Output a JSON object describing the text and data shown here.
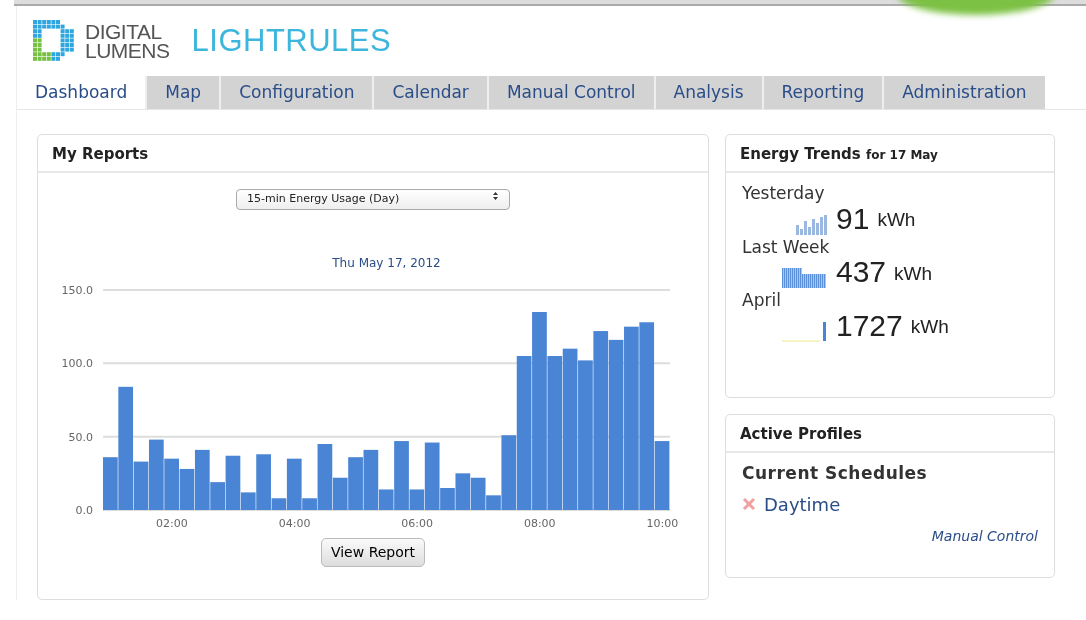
{
  "brand": {
    "company_line_1": "DIGITAL",
    "company_line_2": "LUMENS",
    "product": "LIGHTRULES"
  },
  "tabs": [
    {
      "label": "Dashboard",
      "selected": true
    },
    {
      "label": "Map",
      "selected": false
    },
    {
      "label": "Configuration",
      "selected": false
    },
    {
      "label": "Calendar",
      "selected": false
    },
    {
      "label": "Manual Control",
      "selected": false
    },
    {
      "label": "Analysis",
      "selected": false
    },
    {
      "label": "Reporting",
      "selected": false
    },
    {
      "label": "Administration",
      "selected": false
    }
  ],
  "my_reports": {
    "title": "My Reports",
    "report_select": "15-min Energy Usage (Day)",
    "button": "View Report",
    "chart_data": {
      "type": "bar",
      "title": "Thu May 17, 2012",
      "x": [
        1,
        1.25,
        1.5,
        1.75,
        2,
        2.25,
        2.5,
        2.75,
        3,
        3.25,
        3.5,
        3.75,
        4,
        4.25,
        4.5,
        4.75,
        5,
        5.25,
        5.5,
        5.75,
        6,
        6.25,
        6.5,
        6.75,
        7,
        7.25,
        7.5,
        7.75,
        8,
        8.25,
        8.5,
        8.75,
        9,
        9.25,
        9.5,
        9.75,
        10
      ],
      "series": [
        {
          "color": "#4a84d4",
          "values": [
            36,
            84,
            33,
            48,
            35,
            28,
            41,
            19,
            37,
            12,
            38,
            8,
            35,
            8,
            45,
            22,
            36,
            41,
            14,
            47,
            14,
            46,
            15,
            25,
            22,
            10,
            51,
            105,
            135,
            105,
            110,
            102,
            122,
            116,
            125,
            128,
            47
          ]
        }
      ],
      "xlim": [
        0.875,
        10.125
      ],
      "ylim": [
        0,
        150
      ],
      "yticks": [
        {
          "value": 0,
          "label": "0.0"
        },
        {
          "value": 50,
          "label": "50.0"
        },
        {
          "value": 100,
          "label": "100.0"
        },
        {
          "value": 150,
          "label": "150.0"
        }
      ],
      "xticks": [
        {
          "value": 2,
          "label": "02:00"
        },
        {
          "value": 4,
          "label": "04:00"
        },
        {
          "value": 6,
          "label": "06:00"
        },
        {
          "value": 8,
          "label": "08:00"
        },
        {
          "value": 10,
          "label": "10:00"
        }
      ]
    }
  },
  "energy_trends": {
    "title": "Energy Trends",
    "title_suffix": "for 17 May",
    "rows": [
      {
        "label": "Yesterday",
        "value": "91",
        "unit": "kWh",
        "kind": "day"
      },
      {
        "label": "Last Week",
        "value": "437",
        "unit": "kWh",
        "kind": "week"
      },
      {
        "label": "April",
        "value": "1727",
        "unit": "kWh",
        "kind": "month"
      }
    ]
  },
  "active_profiles": {
    "title": "Active Profiles",
    "subtitle": "Current Schedules",
    "schedules": [
      {
        "name": "Daytime"
      }
    ],
    "link": "Manual Control"
  }
}
